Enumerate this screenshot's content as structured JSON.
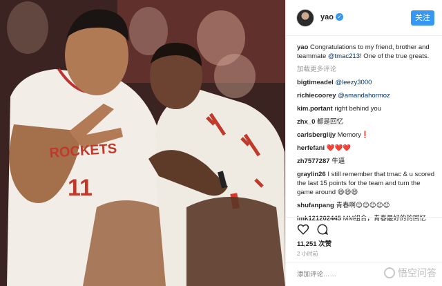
{
  "post": {
    "username": "yao",
    "follow_label": "关注",
    "caption_user": "yao",
    "caption_text": "Congratulations to my friend, brother and teammate ",
    "caption_mention": "@tmac213",
    "caption_end": "! One of the true greats.",
    "load_more": "加载更多评论"
  },
  "comments": [
    {
      "user": "bigtimeadel",
      "text": "",
      "mention": "@leezy3000"
    },
    {
      "user": "richiecoorey",
      "text": "",
      "mention": "@amandahormoz"
    },
    {
      "user": "kim.portant",
      "text": "right behind you",
      "mention": ""
    },
    {
      "user": "zhx_0",
      "text": "都是回忆",
      "mention": ""
    },
    {
      "user": "carlsberglijy",
      "text": "Memory❗️",
      "mention": ""
    },
    {
      "user": "herfefani",
      "text": "❤️❤️❤️",
      "mention": ""
    },
    {
      "user": "zh7577287",
      "text": "牛逼",
      "mention": ""
    },
    {
      "user": "graylin26",
      "text": "I still remember that tmac & u scored the last 15 points for the team and turn the game around 😄😄😄",
      "mention": ""
    },
    {
      "user": "shufanpang",
      "text": "青春啊😊😊😊😊😊",
      "mention": ""
    },
    {
      "user": "lmk121202445",
      "text": "MM组合，青春最好的的回忆",
      "mention": ""
    }
  ],
  "stats": {
    "likes": "11,251 次赞",
    "time": "2 小时前"
  },
  "add_comment": {
    "placeholder": "添加评论……"
  },
  "watermark": "悟空问答",
  "icons": {
    "like": "heart-outline-icon",
    "comment": "comment-bubble-icon",
    "verified": "verified-check-icon"
  },
  "jersey": {
    "team_text": "ROCKETS",
    "number": "11"
  },
  "colors": {
    "accent": "#3897f0",
    "mention": "#003569",
    "muted": "#999999"
  }
}
